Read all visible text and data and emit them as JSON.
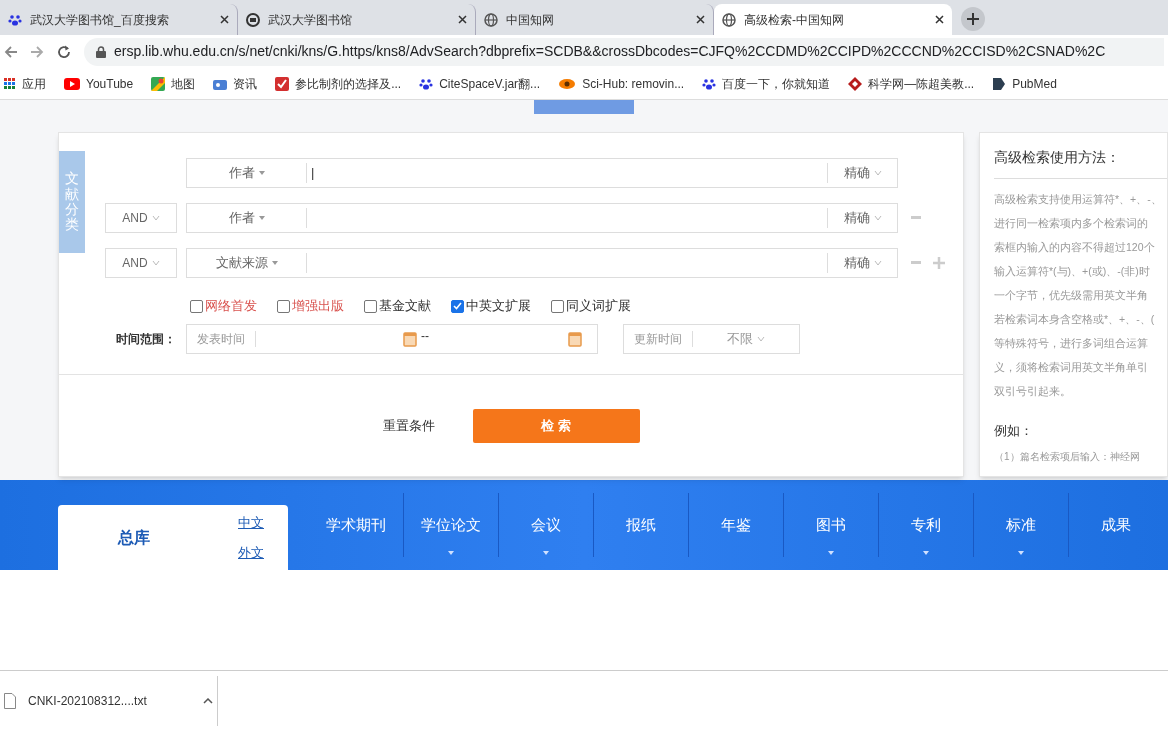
{
  "browser": {
    "tabs": [
      {
        "title": "武汉大学图书馆_百度搜索",
        "selected": false
      },
      {
        "title": "武汉大学图书馆",
        "selected": false
      },
      {
        "title": "中国知网",
        "selected": false
      },
      {
        "title": "高级检索-中国知网",
        "selected": true
      }
    ],
    "url": "ersp.lib.whu.edu.cn/s/net/cnki/kns/G.https/kns8/AdvSearch?dbprefix=SCDB&&crossDbcodes=CJFQ%2CCDMD%2CCIPD%2CCCND%2CCISD%2CSNAD%2C",
    "bookmarks": [
      {
        "label": "应用"
      },
      {
        "label": "YouTube"
      },
      {
        "label": "地图"
      },
      {
        "label": "资讯"
      },
      {
        "label": "参比制剂的选择及..."
      },
      {
        "label": "CiteSpaceV.jar翻..."
      },
      {
        "label": "Sci-Hub: removin..."
      },
      {
        "label": "百度一下，你就知道"
      },
      {
        "label": "科学网—陈超美教..."
      },
      {
        "label": "PubMed"
      }
    ]
  },
  "search": {
    "side_tab": "文献分类",
    "rows": [
      {
        "field": "作者",
        "match": "精确",
        "value": "|",
        "remove_button": false,
        "add_button": false
      },
      {
        "logic": "AND",
        "field": "作者",
        "match": "精确",
        "remove_button": true,
        "add_button": false
      },
      {
        "logic": "AND",
        "field": "文献来源",
        "match": "精确",
        "remove_button": true,
        "add_button": true
      }
    ],
    "options": [
      {
        "label": "网络首发",
        "checked": false,
        "color": "#d9534f"
      },
      {
        "label": "增强出版",
        "checked": false,
        "color": "#d9534f"
      },
      {
        "label": "基金文献",
        "checked": false,
        "color": "#333333"
      },
      {
        "label": "中英文扩展",
        "checked": true,
        "color": "#333333"
      },
      {
        "label": "同义词扩展",
        "checked": false,
        "color": "#333333"
      }
    ],
    "time_label": "时间范围：",
    "publish_placeholder": "发表时间",
    "range_separator": "--",
    "update_label": "更新时间",
    "update_value": "不限",
    "reset_button": "重置条件",
    "search_button": "检 索"
  },
  "help": {
    "title": "高级检索使用方法：",
    "lines": [
      "高级检索支持使用运算符*、+、-、",
      "进行同一检索项内多个检索词的",
      "索框内输入的内容不得超过120个",
      "输入运算符*(与)、+(或)、-(非)时",
      "一个字节，优先级需用英文半角",
      "若检索词本身含空格或*、+、-、(",
      "等特殊符号，进行多词组合运算",
      "义，须将检索词用英文半角单引",
      "双引号引起来。"
    ],
    "example_title": "例如：",
    "example": "（1）篇名检索项后输入：神经网"
  },
  "databases": {
    "main": "总库",
    "main_selected": true,
    "links": [
      "中文",
      "外文"
    ],
    "items": [
      {
        "label": "学术期刊",
        "dropdown": false
      },
      {
        "label": "学位论文",
        "dropdown": true
      },
      {
        "label": "会议",
        "dropdown": true
      },
      {
        "label": "报纸",
        "dropdown": false
      },
      {
        "label": "年鉴",
        "dropdown": false
      },
      {
        "label": "图书",
        "dropdown": true
      },
      {
        "label": "专利",
        "dropdown": true
      },
      {
        "label": "标准",
        "dropdown": true
      },
      {
        "label": "成果",
        "dropdown": false
      }
    ]
  },
  "downloads": [
    {
      "file": "CNKI-202108312....txt"
    }
  ]
}
